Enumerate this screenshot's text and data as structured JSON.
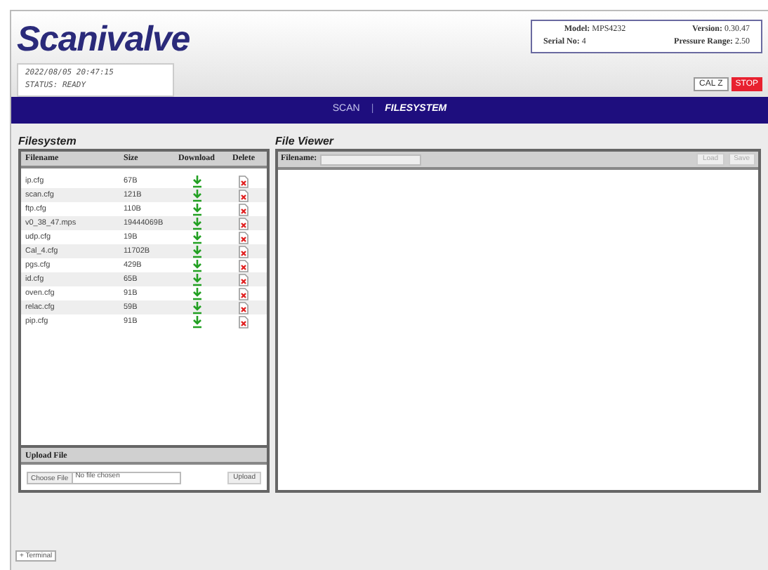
{
  "logo": "Scanivalve",
  "status": {
    "datetime": "2022/08/05 20:47:15",
    "state": "STATUS: READY"
  },
  "device": {
    "model_label": "Model:",
    "model": "MPS4232",
    "version_label": "Version:",
    "version": "0.30.47",
    "serial_label": "Serial No:",
    "serial": "4",
    "range_label": "Pressure Range:",
    "range": "2.50"
  },
  "actions": [
    {
      "label": "CAL Z",
      "kind": "plain"
    },
    {
      "label": "STOP",
      "kind": "danger"
    }
  ],
  "nav": {
    "items": [
      {
        "label": "SCAN",
        "selected": false
      },
      {
        "label": "FILESYSTEM",
        "selected": true
      }
    ],
    "separator": "|"
  },
  "filesystem": {
    "title": "Filesystem",
    "columns": [
      "Filename",
      "Size",
      "Download",
      "Delete"
    ],
    "rows": [
      {
        "name": "ip.cfg",
        "size": "67B"
      },
      {
        "name": "scan.cfg",
        "size": "121B"
      },
      {
        "name": "ftp.cfg",
        "size": "110B"
      },
      {
        "name": "v0_38_47.mps",
        "size": "19444069B"
      },
      {
        "name": "udp.cfg",
        "size": "19B"
      },
      {
        "name": "Cal_4.cfg",
        "size": "11702B"
      },
      {
        "name": "pgs.cfg",
        "size": "429B"
      },
      {
        "name": "id.cfg",
        "size": "65B"
      },
      {
        "name": "oven.cfg",
        "size": "91B"
      },
      {
        "name": "relac.cfg",
        "size": "59B"
      },
      {
        "name": "pip.cfg",
        "size": "91B"
      }
    ],
    "upload": {
      "title": "Upload File",
      "choose": "Choose File",
      "chosen": "No file chosen",
      "button": "Upload"
    }
  },
  "viewer": {
    "title": "File Viewer",
    "filename_label": "Filename:",
    "buttons": [
      {
        "label": "Load",
        "disabled": true
      },
      {
        "label": "Save",
        "disabled": true
      }
    ]
  },
  "terminal": "+ Terminal"
}
